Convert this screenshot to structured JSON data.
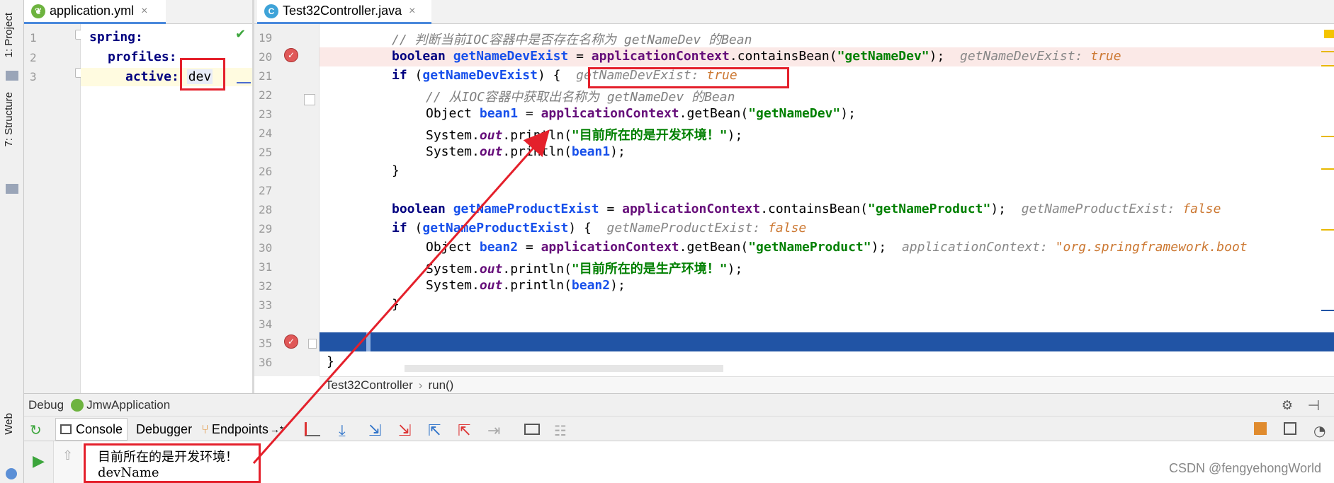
{
  "left_strip": {
    "project_tab": "1: Project",
    "structure_tab": "7: Structure",
    "web_tab": "Web"
  },
  "yml_tab": {
    "label": "application.yml",
    "close": "×"
  },
  "java_tab": {
    "label": "Test32Controller.java",
    "close": "×",
    "icon": "C"
  },
  "yml": {
    "line_numbers": [
      "1",
      "2",
      "3"
    ],
    "lines": [
      {
        "key": "spring:"
      },
      {
        "key": "profiles:"
      },
      {
        "key": "active:",
        "value": "dev"
      }
    ]
  },
  "java": {
    "line_numbers": [
      "19",
      "20",
      "21",
      "22",
      "23",
      "24",
      "25",
      "26",
      "27",
      "28",
      "29",
      "30",
      "31",
      "32",
      "33",
      "34",
      "35",
      "36"
    ],
    "l19": {
      "comment": "// 判断当前IOC容器中是否存在名称为 getNameDev 的Bean"
    },
    "l20": {
      "kw": "boolean",
      "var": "getNameDevExist",
      "eq": " = ",
      "ctx": "applicationContext",
      "call": ".containsBean(",
      "str": "\"getNameDev\"",
      "end": ");",
      "hint_name": "getNameDevExist:",
      "hint_val": "true"
    },
    "l21": {
      "kw": "if",
      "open": " (",
      "var": "getNameDevExist",
      "close": ") {",
      "hint_name": "getNameDevExist:",
      "hint_val": "true"
    },
    "l22": {
      "comment": "// 从IOC容器中获取出名称为 getNameDev 的Bean"
    },
    "l23": {
      "type": "Object ",
      "var": "bean1",
      "eq": " = ",
      "ctx": "applicationContext",
      "call": ".getBean(",
      "str": "\"getNameDev\"",
      "end": ");"
    },
    "l24": {
      "sys": "System.",
      "out": "out",
      "call": ".println(",
      "str": "\"目前所在的是开发环境！\"",
      "end": ");"
    },
    "l25": {
      "sys": "System.",
      "out": "out",
      "call": ".println(",
      "var": "bean1",
      "end": ");"
    },
    "l26": {
      "text": "}"
    },
    "l28": {
      "kw": "boolean",
      "var": "getNameProductExist",
      "eq": " = ",
      "ctx": "applicationContext",
      "call": ".containsBean(",
      "str": "\"getNameProduct\"",
      "end": ");",
      "hint_name": "getNameProductExist:",
      "hint_val": "false"
    },
    "l29": {
      "kw": "if",
      "open": " (",
      "var": "getNameProductExist",
      "close": ") {",
      "hint_name": "getNameProductExist:",
      "hint_val": "false"
    },
    "l30": {
      "type": "Object ",
      "var": "bean2",
      "eq": " = ",
      "ctx": "applicationContext",
      "call": ".getBean(",
      "str": "\"getNameProduct\"",
      "end": ");",
      "hint_name": "applicationContext:",
      "hint_val": "\"org.springframework.boot"
    },
    "l31": {
      "sys": "System.",
      "out": "out",
      "call": ".println(",
      "str": "\"目前所在的是生产环境！\"",
      "end": ");"
    },
    "l32": {
      "sys": "System.",
      "out": "out",
      "call": ".println(",
      "var": "bean2",
      "end": ");"
    },
    "l33": {
      "text": "}"
    },
    "l36": {
      "text": "}"
    }
  },
  "breadcrumb": {
    "class_name": "Test32Controller",
    "sep": "›",
    "method": "run()"
  },
  "debug": {
    "title": "Debug",
    "config": "JmwApplication",
    "tabs": [
      "Console",
      "Debugger",
      "Endpoints"
    ],
    "tabs_overflow": "→*"
  },
  "console": {
    "lines": [
      "目前所在的是开发环境！",
      "devName"
    ]
  },
  "watermark": "CSDN @fengyehongWorld",
  "colors": {
    "highlight_line": "#fbe9e7",
    "execution_line": "#2154a5",
    "annotation_red": "#e4202b",
    "breakpoint": "#e05858"
  }
}
